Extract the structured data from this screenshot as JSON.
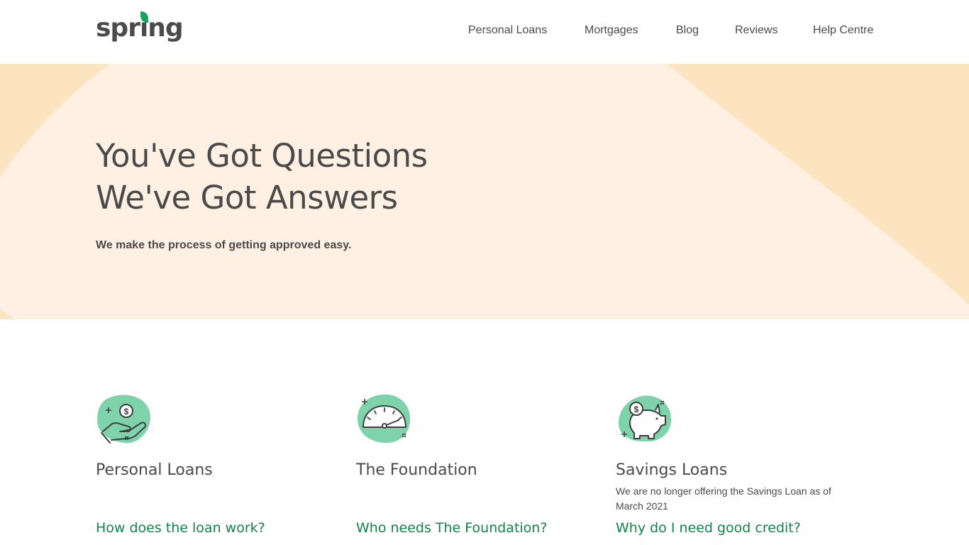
{
  "header": {
    "logo_text": "spring",
    "logo_mark": "®",
    "nav": [
      {
        "label": "Personal Loans"
      },
      {
        "label": "Mortgages"
      },
      {
        "label": "Blog"
      },
      {
        "label": "Reviews"
      },
      {
        "label": "Help Centre"
      }
    ]
  },
  "hero": {
    "title_line1": "You've Got Questions",
    "title_line2": "We've Got Answers",
    "subtitle": "We make the process of getting approved easy."
  },
  "cards": [
    {
      "icon": "hand-coin-icon",
      "title": "Personal Loans",
      "note": "",
      "link": "How does the loan work?"
    },
    {
      "icon": "speedometer-icon",
      "title": "The Foundation",
      "note": "",
      "link": "Who needs The Foundation?"
    },
    {
      "icon": "piggy-bank-icon",
      "title": "Savings Loans",
      "note": "We are no longer offering the Savings Loan as of March 2021",
      "link": "Why do I need good credit?"
    }
  ],
  "colors": {
    "brand_green": "#1aa15f",
    "link_green": "#12834a",
    "hero_light": "#fef1e3",
    "hero_dark": "#fde4c1",
    "icon_blob": "#7fd3ab",
    "text": "#4a4a4a"
  }
}
